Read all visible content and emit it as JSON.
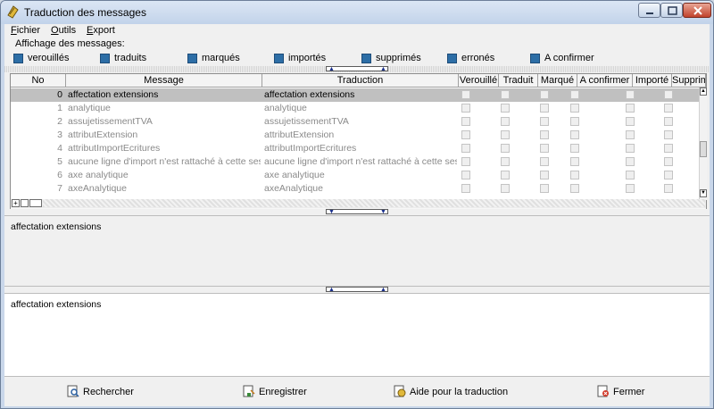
{
  "window": {
    "title": "Traduction des messages"
  },
  "menu": [
    {
      "label": "Fichier",
      "ul": "F",
      "rest": "ichier"
    },
    {
      "label": "Outils",
      "ul": "O",
      "rest": "utils"
    },
    {
      "label": "Export",
      "ul": "E",
      "rest": "xport"
    }
  ],
  "filters": {
    "label": "Affichage des messages:",
    "items": [
      {
        "label": "verouillés",
        "checked": true
      },
      {
        "label": "traduits",
        "checked": true
      },
      {
        "label": "marqués",
        "checked": true
      },
      {
        "label": "importés",
        "checked": true
      },
      {
        "label": "supprimés",
        "checked": true
      },
      {
        "label": "erronés",
        "checked": true
      },
      {
        "label": "A confirmer",
        "checked": true
      }
    ]
  },
  "grid": {
    "columns": [
      "No",
      "Message",
      "Traduction",
      "Verouillé",
      "Traduit",
      "Marqué",
      "A confirmer",
      "Importé",
      "Supprimé"
    ],
    "rows": [
      {
        "no": "0",
        "message": "affectation extensions",
        "traduction": "affectation extensions",
        "selected": true
      },
      {
        "no": "1",
        "message": "analytique",
        "traduction": "analytique"
      },
      {
        "no": "2",
        "message": "assujetissementTVA",
        "traduction": "assujetissementTVA"
      },
      {
        "no": "3",
        "message": "attributExtension",
        "traduction": "attributExtension"
      },
      {
        "no": "4",
        "message": "attributImportEcritures",
        "traduction": "attributImportEcritures"
      },
      {
        "no": "5",
        "message": "aucune ligne d'import n'est rattaché à cette session",
        "traduction": "aucune ligne d'import n'est rattaché à cette session"
      },
      {
        "no": "6",
        "message": "axe analytique",
        "traduction": "axe analytique"
      },
      {
        "no": "7",
        "message": "axeAnalytique",
        "traduction": "axeAnalytique"
      }
    ]
  },
  "source_text": "affectation extensions",
  "translation_text": "affectation extensions",
  "buttons": {
    "search": "Rechercher",
    "save": "Enregistrer",
    "help": "Aide pour la traduction",
    "close": "Fermer"
  },
  "colors": {
    "accent": "#2d6ea6",
    "selection": "#c0c0c0"
  }
}
